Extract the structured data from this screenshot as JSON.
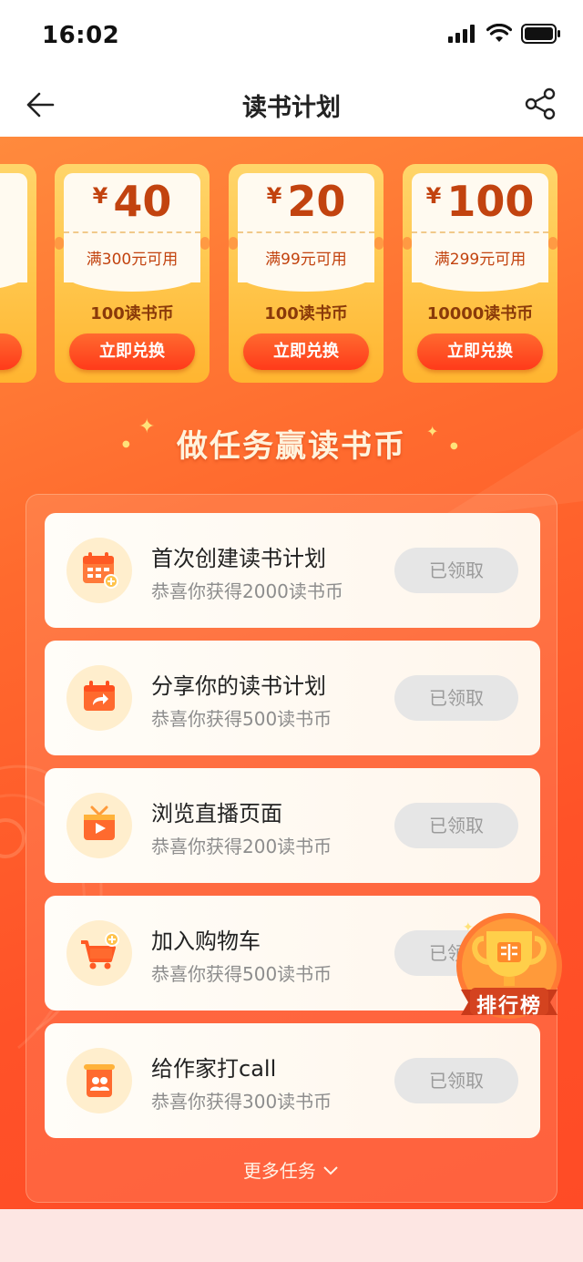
{
  "status": {
    "time": "16:02"
  },
  "nav": {
    "title": "读书计划"
  },
  "coupons": [
    {
      "currency": "¥",
      "amount": "40",
      "condition": "满300元可用",
      "coins": "100读书币",
      "button": "立即兑换"
    },
    {
      "currency": "¥",
      "amount": "20",
      "condition": "满99元可用",
      "coins": "100读书币",
      "button": "立即兑换"
    },
    {
      "currency": "¥",
      "amount": "100",
      "condition": "满299元可用",
      "coins": "10000读书币",
      "button": "立即兑换"
    }
  ],
  "section": {
    "title": "做任务赢读书币"
  },
  "tasks": [
    {
      "icon": "calendar-add-icon",
      "title": "首次创建读书计划",
      "reward": "恭喜你获得2000读书币",
      "button": "已领取"
    },
    {
      "icon": "share-calendar-icon",
      "title": "分享你的读书计划",
      "reward": "恭喜你获得500读书币",
      "button": "已领取"
    },
    {
      "icon": "tv-play-icon",
      "title": "浏览直播页面",
      "reward": "恭喜你获得200读书币",
      "button": "已领取"
    },
    {
      "icon": "cart-add-icon",
      "title": "加入购物车",
      "reward": "恭喜你获得500读书币",
      "button": "已领取"
    },
    {
      "icon": "writer-call-icon",
      "title": "给作家打call",
      "reward": "恭喜你获得300读书币",
      "button": "已领取"
    }
  ],
  "more_tasks": "更多任务",
  "leaderboard": {
    "label": "排行榜"
  },
  "colors": {
    "accent": "#ff5a2a",
    "coupon": "#ffc54a",
    "button_disabled": "#e6e6e6"
  }
}
